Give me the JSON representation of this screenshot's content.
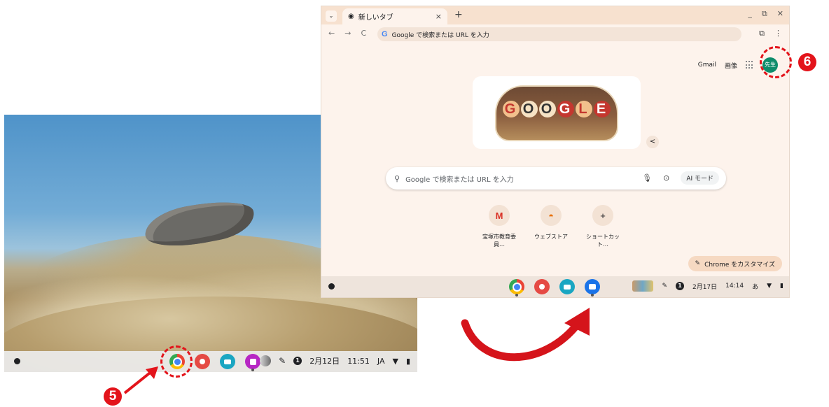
{
  "left_desktop": {
    "shelf_apps": [
      "chrome-icon",
      "palette-icon",
      "camera-app-icon",
      "canvas-app-icon"
    ],
    "tray": {
      "date": "2月12日",
      "time": "11:51",
      "ime": "JA",
      "notification_count": "1"
    }
  },
  "browser": {
    "tab_title": "新しいタブ",
    "tab_close": "×",
    "new_tab": "+",
    "window_controls": [
      "_",
      "⧉",
      "✕"
    ],
    "omnibox_placeholder": "Google で検索または URL を入力",
    "omnibox_g": "G",
    "top_links": {
      "gmail": "Gmail",
      "images": "画像",
      "avatar_text": "先生"
    },
    "doodle_text": [
      "G",
      "O",
      "O",
      "G",
      "L",
      "E"
    ],
    "search_placeholder": "Google で検索または URL を入力",
    "ai_mode_label": "AI モード",
    "shortcuts": [
      {
        "label": "宝塚市教育委員…",
        "glyph": "M"
      },
      {
        "label": "ウェブストア",
        "glyph": "◓"
      },
      {
        "label": "ショートカット…",
        "glyph": "+"
      }
    ],
    "customize_label": "Chrome をカスタマイズ",
    "shelf_tray": {
      "date": "2月17日",
      "time": "14:14",
      "ime": "あ",
      "notification_count": "1"
    }
  },
  "annotations": {
    "marker5": "5",
    "marker6": "6"
  },
  "colors": {
    "marker_red": "#e3141b",
    "avatar_green": "#0d8c6b"
  }
}
